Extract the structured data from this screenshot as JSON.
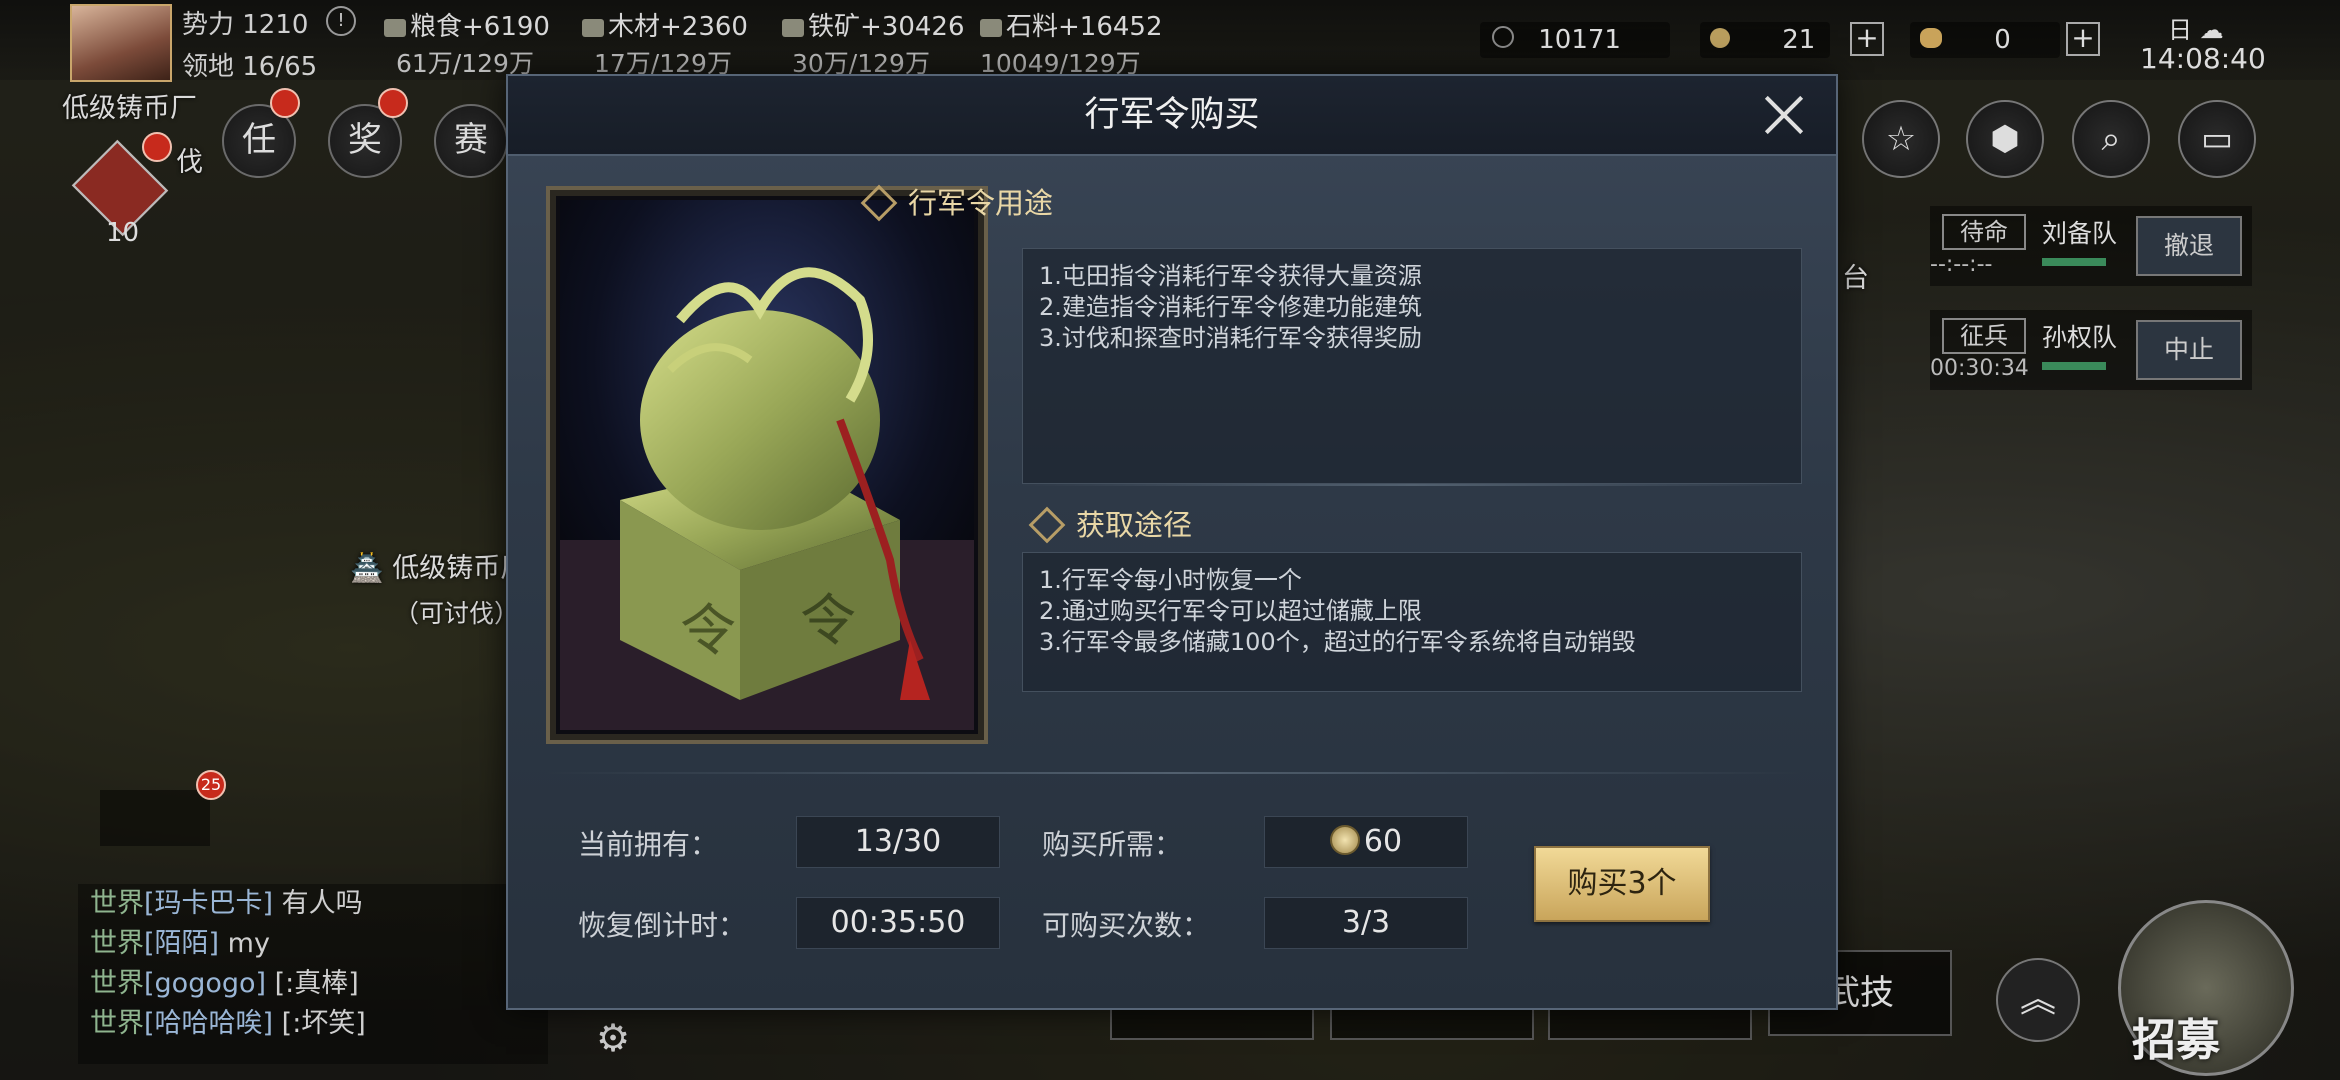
{
  "hud": {
    "power": "势力 1210",
    "territory": "领地 16/65",
    "resources": [
      {
        "name": "粮食",
        "gain": "粮食+6190",
        "capacity": "61万/129万"
      },
      {
        "name": "木材",
        "gain": "木材+2360",
        "capacity": "17万/129万"
      },
      {
        "name": "铁矿",
        "gain": "铁矿+30426",
        "capacity": "30万/129万"
      },
      {
        "name": "石料",
        "gain": "石料+16452",
        "capacity": "10049/129万"
      }
    ],
    "currency_a": "10171",
    "currency_b": "21",
    "currency_c": "0",
    "clock_date": "日",
    "clock_time": "14:08:40"
  },
  "left_hud": {
    "buttons": [
      "任",
      "奖",
      "赛"
    ],
    "task_count": "10",
    "map_labels": [
      "低级铸币厂",
      "低级铸币厂",
      "（可讨伐）",
      "伐"
    ],
    "bag_badge": "25"
  },
  "chat": [
    {
      "channel": "世界",
      "name": "[玛卡巴卡]",
      "msg": "有人吗"
    },
    {
      "channel": "世界",
      "name": "[陌陌]",
      "msg": "my"
    },
    {
      "channel": "世界",
      "name": "[gogogo]",
      "msg": "[:真棒]"
    },
    {
      "channel": "世界",
      "name": "[哈哈哈唉]",
      "msg": "[:坏笑]"
    }
  ],
  "right_hud": {
    "troops": [
      {
        "state": "待命",
        "name": "刘备队",
        "time": "--:--:--",
        "action": "撤退"
      },
      {
        "state": "征兵",
        "name": "孙权队",
        "time": "00:30:34",
        "action": "中止"
      }
    ],
    "map_text": "台",
    "skill_button": "武技",
    "recruit": "招募"
  },
  "modal": {
    "title": "行军令购买",
    "usage_title": "行军令用途",
    "usage_lines": [
      "1.屯田指令消耗行军令获得大量资源",
      "2.建造指令消耗行军令修建功能建筑",
      "3.讨伐和探查时消耗行军令获得奖励"
    ],
    "source_title": "获取途径",
    "source_lines": [
      "1.行军令每小时恢复一个",
      "2.通过购买行军令可以超过储藏上限",
      "3.行军令最多储藏100个，超过的行军令系统将自动销毁"
    ],
    "owned_label": "当前拥有：",
    "owned_value": "13/30",
    "cost_label": "购买所需：",
    "cost_value": "60",
    "countdown_label": "恢复倒计时：",
    "countdown_value": "00:35:50",
    "buy_count_label": "可购买次数：",
    "buy_count_value": "3/3",
    "buy_button": "购买3个"
  },
  "art_seal_chars": [
    "令",
    "令"
  ]
}
